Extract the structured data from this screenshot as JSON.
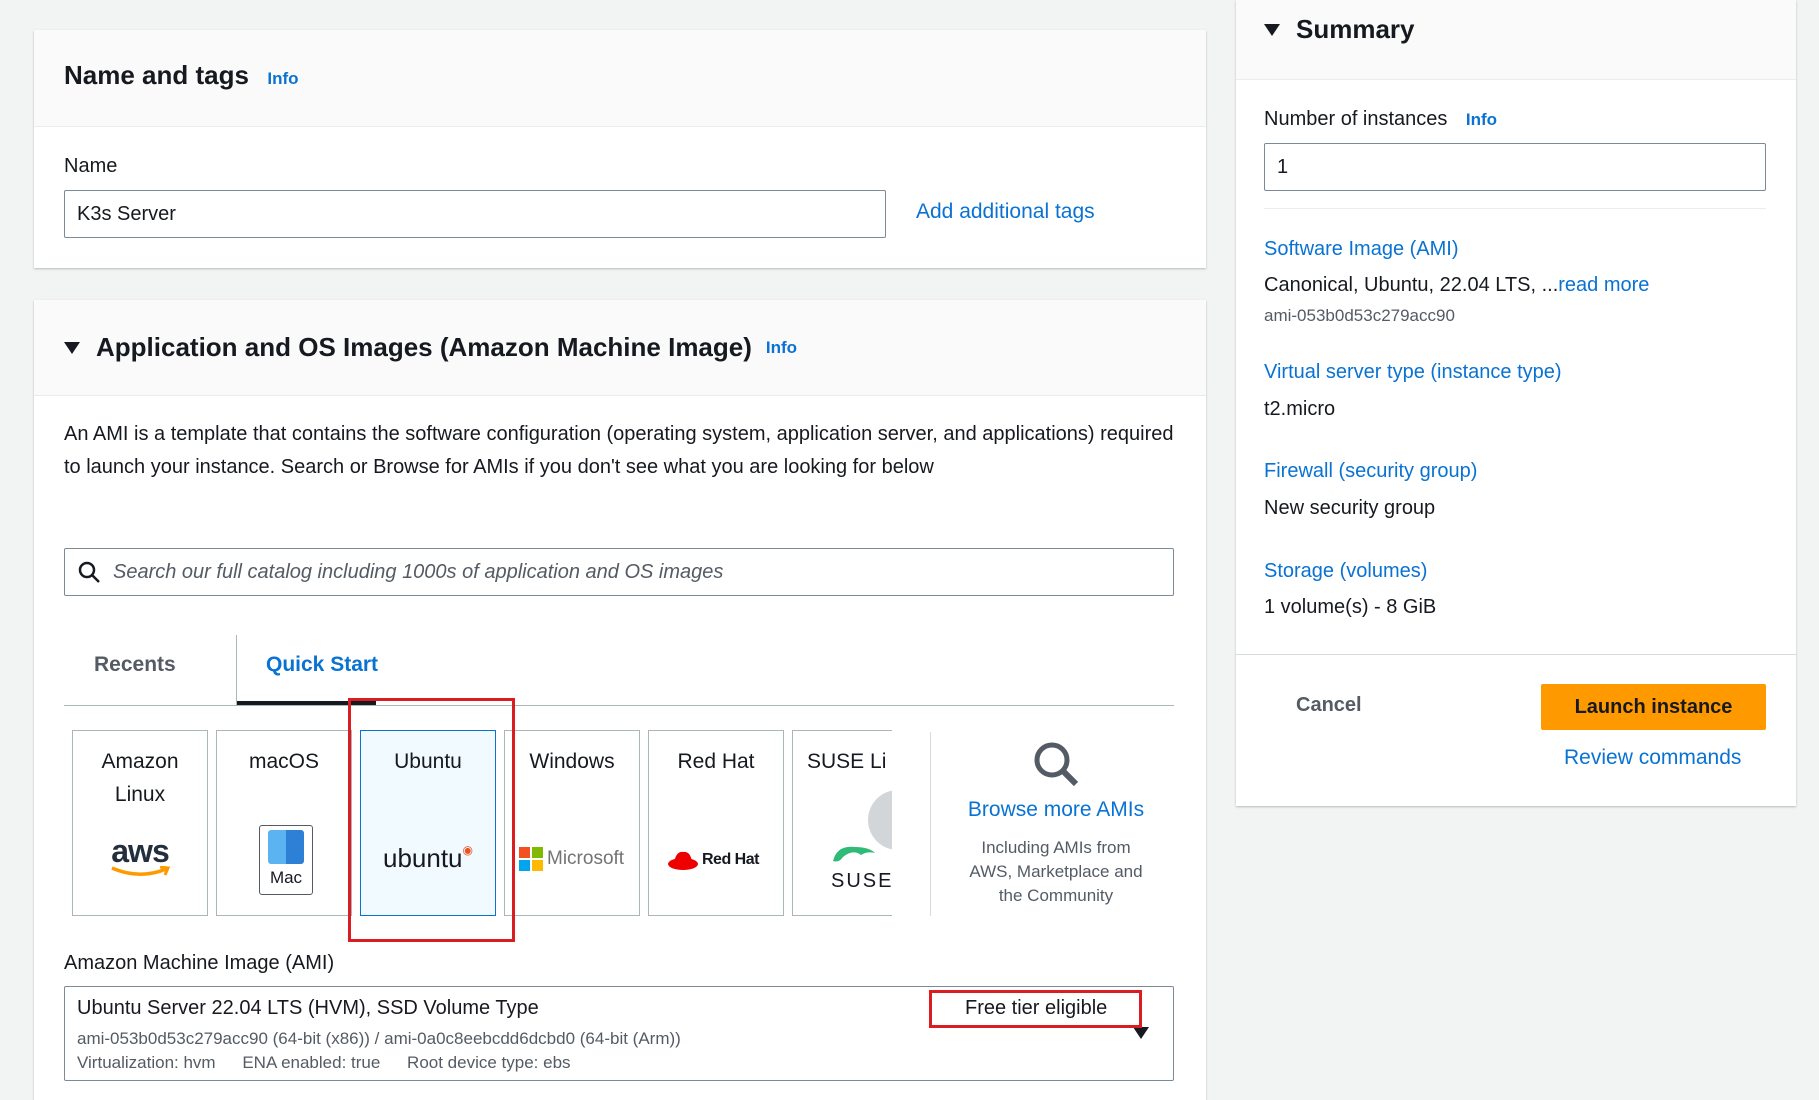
{
  "name_and_tags": {
    "title": "Name and tags",
    "info": "Info",
    "name_label": "Name",
    "name_value": "K3s Server",
    "add_tags": "Add additional tags"
  },
  "ami_section": {
    "title": "Application and OS Images (Amazon Machine Image)",
    "info": "Info",
    "description": "An AMI is a template that contains the software configuration (operating system, application server, and applications) required to launch your instance. Search or Browse for AMIs if you don't see what you are looking for below",
    "search_placeholder": "Search our full catalog including 1000s of application and OS images",
    "tabs": [
      "Recents",
      "Quick Start"
    ],
    "active_tab": "Quick Start",
    "tiles": [
      {
        "name_line1": "Amazon",
        "name_line2": "Linux",
        "logo_text": "aws"
      },
      {
        "name_line1": "macOS",
        "logo_text": "Mac"
      },
      {
        "name_line1": "Ubuntu",
        "logo_text": "ubuntu"
      },
      {
        "name_line1": "Windows",
        "logo_text": "Microsoft"
      },
      {
        "name_line1": "Red Hat",
        "logo_text": "Red Hat"
      },
      {
        "name_line1": "SUSE Li",
        "logo_text": "SUSE"
      }
    ],
    "selected_tile": "Ubuntu",
    "browse_more": "Browse more AMIs",
    "browse_desc": "Including AMIs from AWS, Marketplace and the Community",
    "ami_label": "Amazon Machine Image (AMI)",
    "ami_name": "Ubuntu Server 22.04 LTS (HVM), SSD Volume Type",
    "ami_ids": "ami-053b0d53c279acc90 (64-bit (x86)) / ami-0a0c8eebcdd6dcbd0 (64-bit (Arm))",
    "ami_meta": [
      "Virtualization: hvm",
      "ENA enabled: true",
      "Root device type: ebs"
    ],
    "free_tier": "Free tier eligible"
  },
  "summary": {
    "title": "Summary",
    "instances_label": "Number of instances",
    "info": "Info",
    "instances_value": "1",
    "software_image_label": "Software Image (AMI)",
    "software_image_value": "Canonical, Ubuntu, 22.04 LTS, ...",
    "read_more": "read more",
    "software_image_id": "ami-053b0d53c279acc90",
    "instance_type_label": "Virtual server type (instance type)",
    "instance_type_value": "t2.micro",
    "firewall_label": "Firewall (security group)",
    "firewall_value": "New security group",
    "storage_label": "Storage (volumes)",
    "storage_value": "1 volume(s) - 8 GiB",
    "cancel": "Cancel",
    "launch": "Launch instance",
    "review": "Review commands"
  },
  "colors": {
    "link": "#0972d3",
    "primary_button": "#ff9900",
    "highlight_box": "#d91d21",
    "selected_tile_bg": "#f1faff"
  }
}
